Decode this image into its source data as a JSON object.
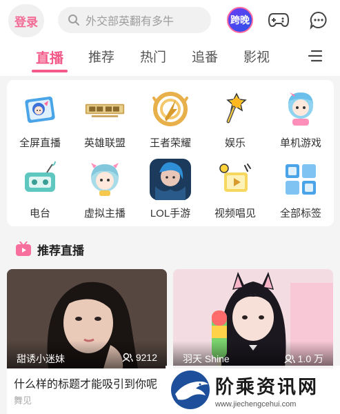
{
  "header": {
    "login_label": "登录",
    "search_placeholder": "外交部英翻有多牛",
    "kuawan_label": "跨晚",
    "icons": [
      "search-icon",
      "gamepad-icon",
      "message-icon"
    ]
  },
  "tabs": [
    {
      "label": "直播",
      "active": true
    },
    {
      "label": "推荐",
      "active": false
    },
    {
      "label": "热门",
      "active": false
    },
    {
      "label": "追番",
      "active": false
    },
    {
      "label": "影视",
      "active": false
    }
  ],
  "categories": [
    {
      "label": "全屏直播",
      "icon": "fullscreen-live-icon"
    },
    {
      "label": "英雄联盟",
      "icon": "league-of-legends-logo"
    },
    {
      "label": "王者荣耀",
      "icon": "honor-of-kings-logo"
    },
    {
      "label": "娱乐",
      "icon": "microphone-icon"
    },
    {
      "label": "单机游戏",
      "icon": "single-player-icon"
    },
    {
      "label": "电台",
      "icon": "radio-icon"
    },
    {
      "label": "虚拟主播",
      "icon": "virtual-streamer-icon"
    },
    {
      "label": "LOL手游",
      "icon": "lol-mobile-icon"
    },
    {
      "label": "视频唱见",
      "icon": "video-singing-icon"
    },
    {
      "label": "全部标签",
      "icon": "all-tags-icon"
    }
  ],
  "section": {
    "title": "推荐直播",
    "icon": "tv-icon"
  },
  "streams": [
    {
      "streamer": "甜诱小迷妹",
      "viewers": "9212",
      "title": "什么样的标题才能吸引到你呢",
      "category": "舞见"
    },
    {
      "streamer": "羽天 Shine",
      "viewers": "1.0 万",
      "title": "",
      "category": ""
    }
  ],
  "watermark": {
    "name": "阶乘资讯网",
    "url": "www.jiechengcehui.com"
  },
  "colors": {
    "accent": "#f35a8a",
    "login_text": "#f36b95",
    "background": "#f4f4f4"
  }
}
